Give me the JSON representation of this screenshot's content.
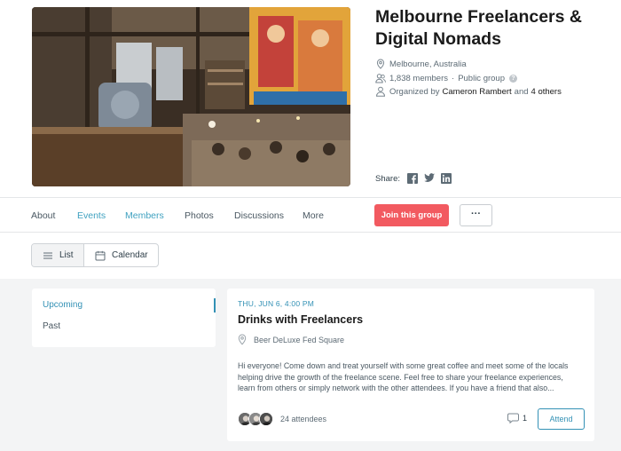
{
  "group": {
    "title": "Melbourne Freelancers & Digital Nomads",
    "location": "Melbourne, Australia",
    "members_text": "1,838 members",
    "separator": "·",
    "visibility": "Public group",
    "help_glyph": "?",
    "organized_prefix": "Organized by",
    "organizer": "Cameron Rambert",
    "organizer_joiner": "and",
    "organizer_others": "4 others",
    "share_label": "Share:",
    "share_icons": [
      "facebook-icon",
      "twitter-icon",
      "linkedin-icon"
    ]
  },
  "nav": {
    "items": [
      {
        "label": "About",
        "active": false
      },
      {
        "label": "Events",
        "active": true
      },
      {
        "label": "Members",
        "active": true
      },
      {
        "label": "Photos",
        "active": false
      },
      {
        "label": "Discussions",
        "active": false
      },
      {
        "label": "More",
        "active": false
      }
    ],
    "join_label": "Join this group",
    "more_label": "···"
  },
  "view_toggle": {
    "list_label": "List",
    "calendar_label": "Calendar",
    "selected": "List"
  },
  "sidebar": {
    "items": [
      {
        "label": "Upcoming",
        "selected": true
      },
      {
        "label": "Past",
        "selected": false
      }
    ]
  },
  "event": {
    "date": "THU, JUN 6, 4:00 PM",
    "title": "Drinks with Freelancers",
    "venue": "Beer DeLuxe Fed Square",
    "description": "Hi everyone! Come down and treat yourself with some great coffee and meet some of the locals helping drive the growth of the freelance scene. Feel free to share your freelance experiences, learn from others or simply network with the other attendees. If you have a friend that also...",
    "attendees": "24 attendees",
    "comment_count": "1",
    "attend_label": "Attend"
  },
  "colors": {
    "accent": "#3391b5",
    "join_button": "#f25a60",
    "content_background": "#f3f4f5"
  }
}
